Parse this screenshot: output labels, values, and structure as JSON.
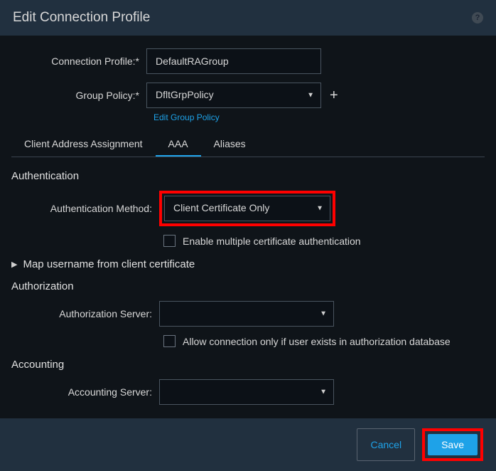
{
  "header": {
    "title": "Edit Connection Profile"
  },
  "form": {
    "connectionProfile": {
      "label": "Connection Profile:*",
      "value": "DefaultRAGroup"
    },
    "groupPolicy": {
      "label": "Group Policy:*",
      "value": "DfltGrpPolicy",
      "editLink": "Edit Group Policy"
    }
  },
  "tabs": {
    "clientAddress": "Client Address Assignment",
    "aaa": "AAA",
    "aliases": "Aliases"
  },
  "authentication": {
    "header": "Authentication",
    "method": {
      "label": "Authentication Method:",
      "value": "Client Certificate Only"
    },
    "enableMultiple": "Enable multiple certificate authentication",
    "mapUsername": "Map username from client certificate"
  },
  "authorization": {
    "header": "Authorization",
    "server": {
      "label": "Authorization Server:",
      "value": ""
    },
    "allowOnly": "Allow connection only if user exists in authorization database"
  },
  "accounting": {
    "header": "Accounting",
    "server": {
      "label": "Accounting Server:",
      "value": ""
    }
  },
  "footer": {
    "cancel": "Cancel",
    "save": "Save"
  }
}
